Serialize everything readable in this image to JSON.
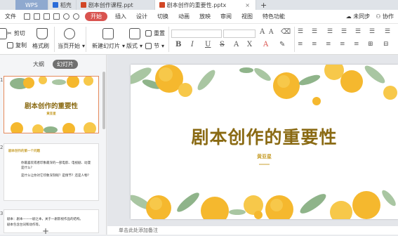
{
  "tabs": [
    {
      "label": "WPS",
      "kind": "home"
    },
    {
      "label": "稻壳",
      "kind": "docer"
    },
    {
      "label": "剧本创作课程.ppt",
      "kind": "ppt"
    },
    {
      "label": "剧本创作的重要性.pptx",
      "kind": "ppt",
      "active": true
    }
  ],
  "menu": {
    "file": "文件",
    "items": [
      "开始",
      "插入",
      "设计",
      "切换",
      "动画",
      "放映",
      "审阅",
      "视图",
      "特色功能"
    ],
    "sync": "未同步",
    "collab": "协作"
  },
  "ribbon": {
    "cut": "剪切",
    "copy": "复制",
    "format_painter": "格式刷",
    "play_from_current": "当页开始",
    "new_slide": "新建幻灯片",
    "layout": "版式",
    "section": "节",
    "reset": "重置"
  },
  "panel": {
    "tab_outline": "大纲",
    "tab_slides": "幻灯片"
  },
  "thumbnails": [
    {
      "title": "剧本创作的重要性",
      "author": "黄亚星"
    },
    {
      "heading": "剧本创作的第一个问题",
      "bullets": [
        "你最喜欢或者印象最深的一部电影、电视剧、动漫是什么？",
        "是什么让你对它印象深刻呢？是情节？还是人物？"
      ]
    },
    {
      "text_lines": [
        "剧本：剧本——一剧之本，关于一剧影视作品的结构。",
        "剧本包含台词和动作等。"
      ]
    }
  ],
  "slide": {
    "title": "剧本创作的重要性",
    "author": "黄亚星"
  },
  "notes_placeholder": "单击此处添加备注",
  "colors": {
    "accent_red": "#d9534f",
    "title_brown": "#8a6a13",
    "flower_yellow": "#f5b82e",
    "leaf_green": "#8fb48a"
  }
}
